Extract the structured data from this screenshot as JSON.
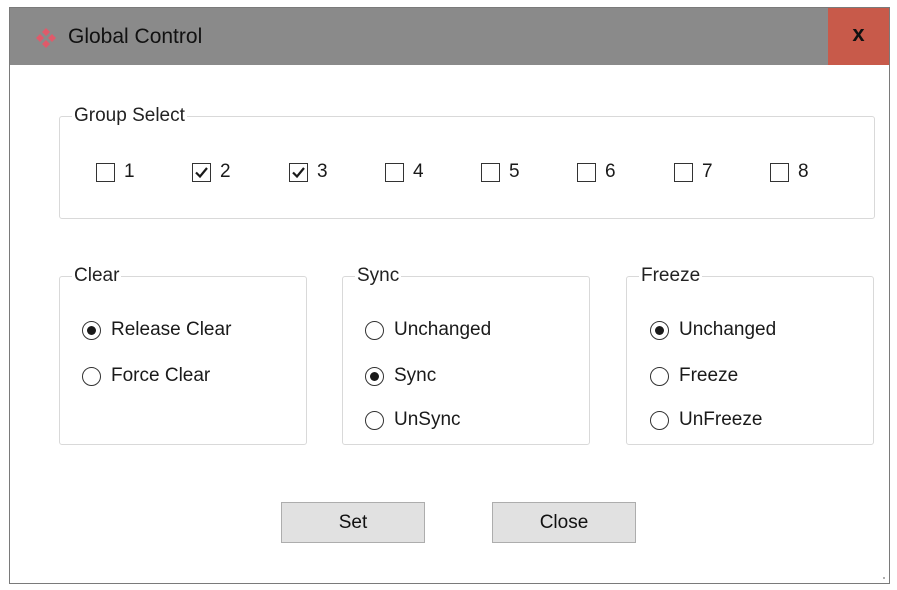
{
  "window": {
    "title": "Global Control",
    "close_label": "x",
    "titlebar_color": "#8a8a8a",
    "close_color": "#c85a4a"
  },
  "group_select": {
    "legend": "Group Select",
    "items": [
      {
        "label": "1",
        "checked": false
      },
      {
        "label": "2",
        "checked": true
      },
      {
        "label": "3",
        "checked": true
      },
      {
        "label": "4",
        "checked": false
      },
      {
        "label": "5",
        "checked": false
      },
      {
        "label": "6",
        "checked": false
      },
      {
        "label": "7",
        "checked": false
      },
      {
        "label": "8",
        "checked": false
      }
    ]
  },
  "clear": {
    "legend": "Clear",
    "options": [
      {
        "label": "Release Clear",
        "selected": true
      },
      {
        "label": "Force Clear",
        "selected": false
      }
    ]
  },
  "sync": {
    "legend": "Sync",
    "options": [
      {
        "label": "Unchanged",
        "selected": false
      },
      {
        "label": "Sync",
        "selected": true
      },
      {
        "label": "UnSync",
        "selected": false
      }
    ]
  },
  "freeze": {
    "legend": "Freeze",
    "options": [
      {
        "label": "Unchanged",
        "selected": true
      },
      {
        "label": "Freeze",
        "selected": false
      },
      {
        "label": "UnFreeze",
        "selected": false
      }
    ]
  },
  "buttons": {
    "set_label": "Set",
    "close_label": "Close"
  }
}
